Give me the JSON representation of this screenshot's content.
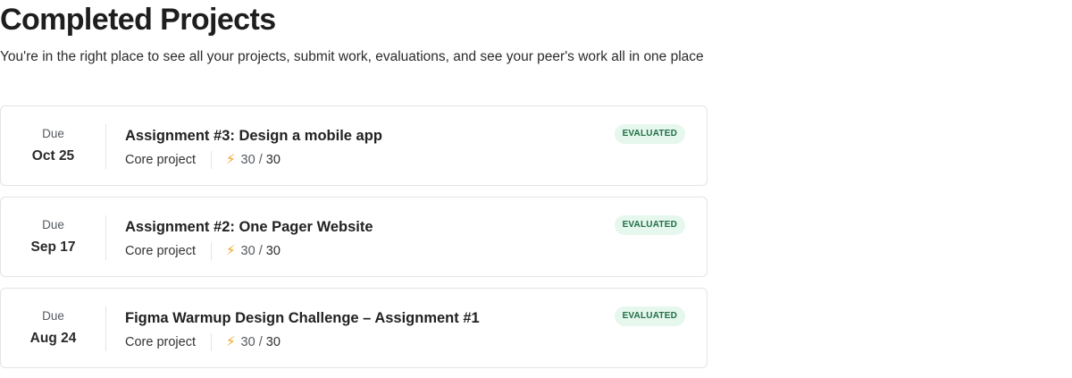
{
  "header": {
    "title": "Completed Projects",
    "subtitle": "You're in the right place to see all your projects, submit work, evaluations, and see your peer's work all in one place"
  },
  "projects": [
    {
      "due_label": "Due",
      "due_date": "Oct 25",
      "title": "Assignment #3: Design a mobile app",
      "type": "Core project",
      "score": "30",
      "score_separator": "/",
      "score_total": "30",
      "status": "EVALUATED",
      "icon": "lightning-bolt-icon"
    },
    {
      "due_label": "Due",
      "due_date": "Sep 17",
      "title": "Assignment #2: One Pager Website",
      "type": "Core project",
      "score": "30",
      "score_separator": "/",
      "score_total": "30",
      "status": "EVALUATED",
      "icon": "lightning-bolt-icon"
    },
    {
      "due_label": "Due",
      "due_date": "Aug 24",
      "title": "Figma Warmup Design Challenge – Assignment #1",
      "type": "Core project",
      "score": "30",
      "score_separator": "/",
      "score_total": "30",
      "status": "EVALUATED",
      "icon": "lightning-bolt-icon"
    }
  ],
  "colors": {
    "badge_bg": "#e6f7ee",
    "badge_text": "#1e6e43",
    "bolt": "#f0a020",
    "border": "#e3e4e6"
  }
}
